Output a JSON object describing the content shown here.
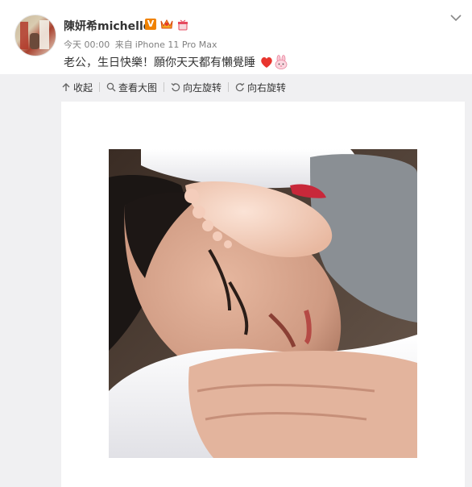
{
  "user": {
    "name": "陳妍希michelle",
    "verified_badge": "V"
  },
  "post": {
    "time": "今天 00:00",
    "source_prefix": "来自",
    "source_device": "iPhone 11 Pro Max",
    "text": "老公，生日快樂！願你天天都有懶覺睡"
  },
  "toolbar": {
    "collapse_label": "收起",
    "view_large_label": "查看大图",
    "rotate_left_label": "向左旋转",
    "rotate_right_label": "向右旋转"
  },
  "icons": {
    "more": "chevron-down-icon",
    "heart": "heart-icon",
    "bunny": "bunny-emoji-icon",
    "crown": "crown-icon",
    "gift": "gift-icon"
  },
  "colors": {
    "badge_orange": "#f08200",
    "heart_red": "#e8352e",
    "media_bg": "#f0f0f2"
  }
}
